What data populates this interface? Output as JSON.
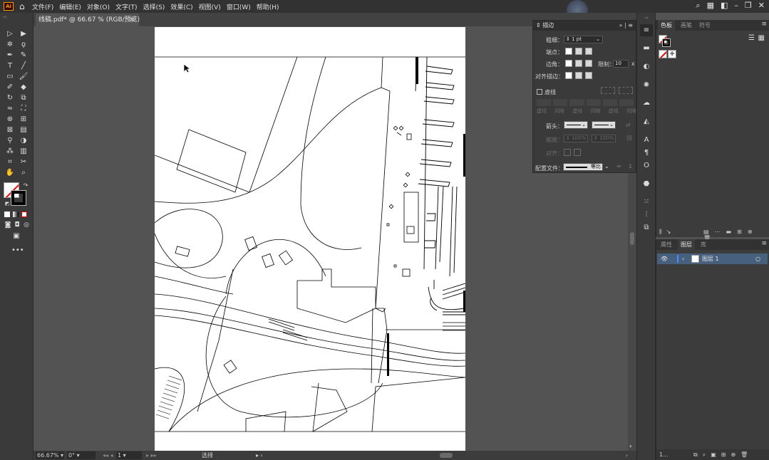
{
  "menubar": {
    "app_logo": "Ai",
    "items": [
      "文件(F)",
      "编辑(E)",
      "对象(O)",
      "文字(T)",
      "选择(S)",
      "效果(C)",
      "视图(V)",
      "窗口(W)",
      "帮助(H)"
    ]
  },
  "document": {
    "tab_title": "线稿.pdf* @ 66.67 % (RGB/预览)",
    "close_glyph": "×"
  },
  "statusbar": {
    "zoom": "66.67%",
    "rotation": "0°",
    "page": "1",
    "mode": "选择"
  },
  "stroke_panel": {
    "title": "描边",
    "weight_label": "粗细：",
    "weight_value": "1 pt",
    "cap_label": "端点：",
    "corner_label": "边角：",
    "limit_label": "限制：",
    "limit_value": "10",
    "limit_unit": "x",
    "align_label": "对齐描边：",
    "dashed_label": "虚线",
    "dash_headers": [
      "虚线",
      "间隙",
      "虚线",
      "间隙",
      "虚线",
      "间隙"
    ],
    "arrow_label": "箭头：",
    "scale_label": "缩放：",
    "scale_start": "100%",
    "scale_end": "100%",
    "align_arrow_label": "对齐：",
    "profile_label": "配置文件：",
    "profile_value": "等比"
  },
  "swatch_panel": {
    "tabs": [
      "色板",
      "画笔",
      "符号"
    ]
  },
  "layers_panel": {
    "tabs": [
      "属性",
      "图层",
      "库"
    ],
    "layer_name": "图层 1",
    "footer_count": "1..."
  },
  "colors": {
    "ui_bg": "#535353",
    "panel_bg": "#3c3c3c",
    "artboard": "#ffffff",
    "layer_highlight": "#46607e",
    "logo_accent": "#ff9a00"
  }
}
